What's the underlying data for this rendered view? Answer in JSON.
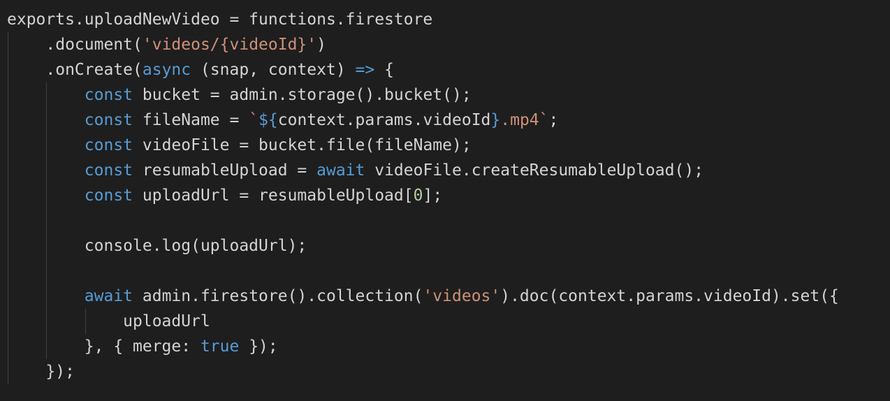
{
  "editor": {
    "language": "javascript",
    "theme": {
      "background": "#1e1e1e",
      "text": "#d4d4d4",
      "keyword": "#569cd6",
      "string": "#ce9178",
      "number": "#b5cea8",
      "indent_guide": "#404040"
    },
    "lines": [
      {
        "indent": 0,
        "tokens": [
          {
            "t": "exports.uploadNewVideo = functions.firestore",
            "k": "plain"
          }
        ]
      },
      {
        "indent": 1,
        "tokens": [
          {
            "t": ".document(",
            "k": "plain"
          },
          {
            "t": "'videos/{videoId}'",
            "k": "str"
          },
          {
            "t": ")",
            "k": "plain"
          }
        ]
      },
      {
        "indent": 1,
        "tokens": [
          {
            "t": ".onCreate(",
            "k": "plain"
          },
          {
            "t": "async",
            "k": "kw"
          },
          {
            "t": " (snap, context) ",
            "k": "plain"
          },
          {
            "t": "=>",
            "k": "kw"
          },
          {
            "t": " {",
            "k": "plain"
          }
        ]
      },
      {
        "indent": 2,
        "tokens": [
          {
            "t": "const",
            "k": "kw"
          },
          {
            "t": " bucket = admin.storage().bucket();",
            "k": "plain"
          }
        ]
      },
      {
        "indent": 2,
        "tokens": [
          {
            "t": "const",
            "k": "kw"
          },
          {
            "t": " fileName = ",
            "k": "plain"
          },
          {
            "t": "`",
            "k": "str"
          },
          {
            "t": "${",
            "k": "kw"
          },
          {
            "t": "context.params.videoId",
            "k": "plain"
          },
          {
            "t": "}",
            "k": "kw"
          },
          {
            "t": ".mp4`",
            "k": "str"
          },
          {
            "t": ";",
            "k": "plain"
          }
        ]
      },
      {
        "indent": 2,
        "tokens": [
          {
            "t": "const",
            "k": "kw"
          },
          {
            "t": " videoFile = bucket.file(fileName);",
            "k": "plain"
          }
        ]
      },
      {
        "indent": 2,
        "tokens": [
          {
            "t": "const",
            "k": "kw"
          },
          {
            "t": " resumableUpload = ",
            "k": "plain"
          },
          {
            "t": "await",
            "k": "kw"
          },
          {
            "t": " videoFile.createResumableUpload();",
            "k": "plain"
          }
        ]
      },
      {
        "indent": 2,
        "tokens": [
          {
            "t": "const",
            "k": "kw"
          },
          {
            "t": " uploadUrl = resumableUpload[",
            "k": "plain"
          },
          {
            "t": "0",
            "k": "num"
          },
          {
            "t": "];",
            "k": "plain"
          }
        ]
      },
      {
        "indent": 0,
        "tokens": []
      },
      {
        "indent": 2,
        "tokens": [
          {
            "t": "console.log(uploadUrl);",
            "k": "plain"
          }
        ]
      },
      {
        "indent": 0,
        "tokens": []
      },
      {
        "indent": 2,
        "tokens": [
          {
            "t": "await",
            "k": "kw"
          },
          {
            "t": " admin.firestore().collection(",
            "k": "plain"
          },
          {
            "t": "'videos'",
            "k": "str"
          },
          {
            "t": ").doc(context.params.videoId).set({",
            "k": "plain"
          }
        ]
      },
      {
        "indent": 3,
        "tokens": [
          {
            "t": "uploadUrl",
            "k": "plain"
          }
        ]
      },
      {
        "indent": 2,
        "tokens": [
          {
            "t": "}, { merge: ",
            "k": "plain"
          },
          {
            "t": "true",
            "k": "kw"
          },
          {
            "t": " });",
            "k": "plain"
          }
        ]
      },
      {
        "indent": 1,
        "tokens": [
          {
            "t": "});",
            "k": "plain"
          }
        ]
      }
    ]
  }
}
